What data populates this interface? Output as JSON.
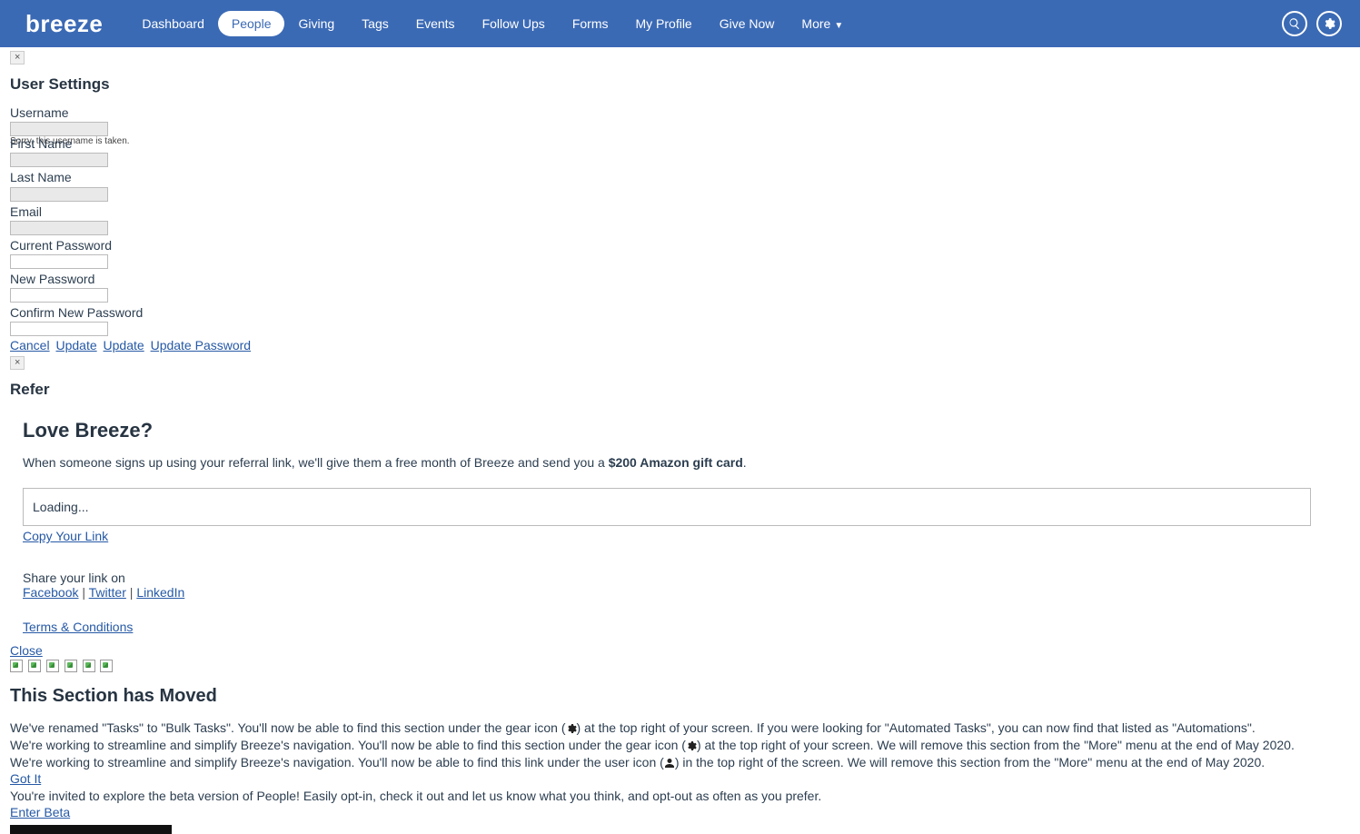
{
  "nav": {
    "logo": "breeze",
    "items": [
      {
        "label": "Dashboard",
        "active": false
      },
      {
        "label": "People",
        "active": true
      },
      {
        "label": "Giving",
        "active": false
      },
      {
        "label": "Tags",
        "active": false
      },
      {
        "label": "Events",
        "active": false
      },
      {
        "label": "Follow Ups",
        "active": false
      },
      {
        "label": "Forms",
        "active": false
      },
      {
        "label": "My Profile",
        "active": false
      },
      {
        "label": "Give Now",
        "active": false
      },
      {
        "label": "More",
        "active": false,
        "dropdown": true
      }
    ]
  },
  "settings": {
    "heading": "User Settings",
    "username_label": "Username",
    "username_value": "",
    "username_error": "Sorry, this username is taken.",
    "firstname_label": "First Name",
    "firstname_value": "",
    "lastname_label": "Last Name",
    "lastname_value": "",
    "email_label": "Email",
    "email_value": "",
    "currentpw_label": "Current Password",
    "newpw_label": "New Password",
    "confirmpw_label": "Confirm New Password"
  },
  "actions": {
    "cancel": "Cancel",
    "update1": "Update",
    "update2": "Update",
    "update_password": "Update Password"
  },
  "refer": {
    "heading": "Refer",
    "title": "Love Breeze?",
    "desc_pre": "When someone signs up using your referral link, we'll give them a free month of Breeze and send you a ",
    "desc_bold": "$200 Amazon gift card",
    "desc_post": ".",
    "box_text": "Loading...",
    "copy_link": "Copy Your Link",
    "share_label": "Share your link on",
    "facebook": "Facebook",
    "twitter": "Twitter",
    "linkedin": "LinkedIn",
    "terms": "Terms & Conditions",
    "close": "Close"
  },
  "moved": {
    "heading": "This Section has Moved",
    "p1a": "We've renamed \"Tasks\" to \"Bulk Tasks\". You'll now be able to find this section under the gear icon (",
    "p1b": ") at the top right of your screen. If you were looking for \"Automated Tasks\", you can now find that listed as \"Automations\".",
    "p2a": "We're working to streamline and simplify Breeze's navigation. You'll now be able to find this section under the gear icon (",
    "p2b": ") at the top right of your screen. We will remove this section from the \"More\" menu at the end of May 2020.",
    "p3a": "We're working to streamline and simplify Breeze's navigation. You'll now be able to find this link under the user icon (",
    "p3b": ") in the top right of the screen. We will remove this section from the \"More\" menu at the end of May 2020.",
    "got_it": "Got It",
    "beta_invite": "You're invited to explore the beta version of People! Easily opt-in, check it out and let us know what you think, and opt-out as often as you prefer.",
    "enter_beta": "Enter Beta"
  }
}
